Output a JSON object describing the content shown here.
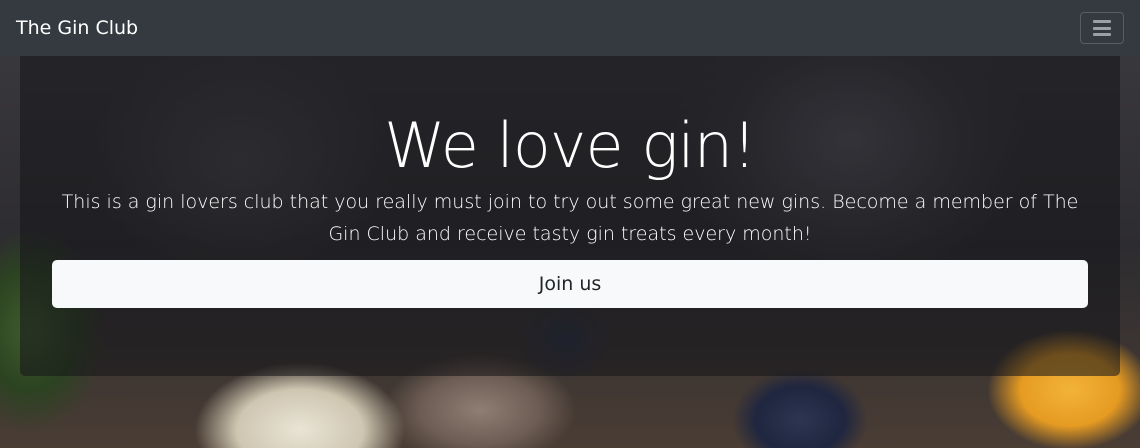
{
  "navbar": {
    "brand": "The Gin Club",
    "toggler_icon": "hamburger-menu-icon"
  },
  "hero": {
    "headline": "We love gin!",
    "lead": "This is a gin lovers club that you really must join to try out some great new gins. Become a member of The Gin Club and receive tasty gin treats every month!",
    "cta_label": "Join us"
  },
  "colors": {
    "navbar_bg": "#343a40",
    "button_bg": "#f8f9fa",
    "text_light": "#ffffff"
  }
}
